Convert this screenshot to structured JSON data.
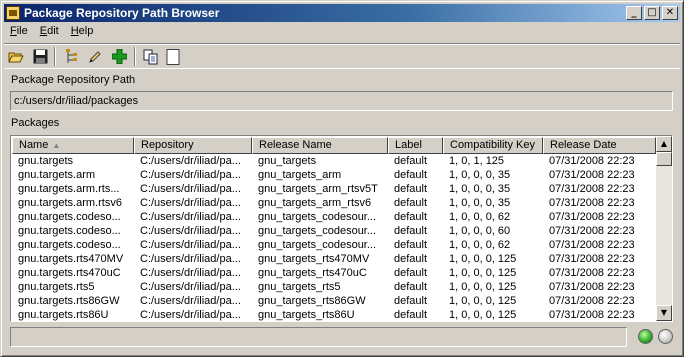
{
  "window": {
    "title": "Package Repository Path Browser",
    "controls": {
      "minimize": "_",
      "maximize": "□",
      "close": "✕"
    }
  },
  "menu": [
    {
      "prefix": "",
      "accel": "F",
      "rest": "ile"
    },
    {
      "prefix": "",
      "accel": "E",
      "rest": "dit"
    },
    {
      "prefix": "",
      "accel": "H",
      "rest": "elp"
    }
  ],
  "toolbar": {
    "icons": [
      "open-folder-icon",
      "save-disk-icon",
      "tree-icon",
      "edit-pencil-icon",
      "add-plus-icon",
      "copy-icon",
      "blank-page-icon"
    ]
  },
  "path_section": {
    "label": "Package Repository Path",
    "value": "c:/users/dr/iliad/packages"
  },
  "packages_section": {
    "label": "Packages",
    "columns": [
      "Name",
      "Repository",
      "Release Name",
      "Label",
      "Compatibility Key",
      "Release Date"
    ],
    "sort_indicator": "▲",
    "rows": [
      [
        "gnu.targets",
        "C:/users/dr/iliad/pa...",
        "gnu_targets",
        "default",
        "1, 0, 1, 125",
        "07/31/2008  22:23"
      ],
      [
        "gnu.targets.arm",
        "C:/users/dr/iliad/pa...",
        "gnu_targets_arm",
        "default",
        "1, 0, 0, 0, 35",
        "07/31/2008  22:23"
      ],
      [
        "gnu.targets.arm.rts...",
        "C:/users/dr/iliad/pa...",
        "gnu_targets_arm_rtsv5T",
        "default",
        "1, 0, 0, 0, 35",
        "07/31/2008  22:23"
      ],
      [
        "gnu.targets.arm.rtsv6",
        "C:/users/dr/iliad/pa...",
        "gnu_targets_arm_rtsv6",
        "default",
        "1, 0, 0, 0, 35",
        "07/31/2008  22:23"
      ],
      [
        "gnu.targets.codeso...",
        "C:/users/dr/iliad/pa...",
        "gnu_targets_codesour...",
        "default",
        "1, 0, 0, 0, 62",
        "07/31/2008  22:23"
      ],
      [
        "gnu.targets.codeso...",
        "C:/users/dr/iliad/pa...",
        "gnu_targets_codesour...",
        "default",
        "1, 0, 0, 0, 60",
        "07/31/2008  22:23"
      ],
      [
        "gnu.targets.codeso...",
        "C:/users/dr/iliad/pa...",
        "gnu_targets_codesour...",
        "default",
        "1, 0, 0, 0, 62",
        "07/31/2008  22:23"
      ],
      [
        "gnu.targets.rts470MV",
        "C:/users/dr/iliad/pa...",
        "gnu_targets_rts470MV",
        "default",
        "1, 0, 0, 0, 125",
        "07/31/2008  22:23"
      ],
      [
        "gnu.targets.rts470uC",
        "C:/users/dr/iliad/pa...",
        "gnu_targets_rts470uC",
        "default",
        "1, 0, 0, 0, 125",
        "07/31/2008  22:23"
      ],
      [
        "gnu.targets.rts5",
        "C:/users/dr/iliad/pa...",
        "gnu_targets_rts5",
        "default",
        "1, 0, 0, 0, 125",
        "07/31/2008  22:23"
      ],
      [
        "gnu.targets.rts86GW",
        "C:/users/dr/iliad/pa...",
        "gnu_targets_rts86GW",
        "default",
        "1, 0, 0, 0, 125",
        "07/31/2008  22:23"
      ],
      [
        "gnu.targets.rts86U",
        "C:/users/dr/iliad/pa...",
        "gnu_targets_rts86U",
        "default",
        "1, 0, 0, 0, 125",
        "07/31/2008  22:23"
      ]
    ]
  },
  "scrollbar": {
    "up": "▲",
    "down": "▼"
  },
  "status": {
    "text": "",
    "indicators": [
      {
        "name": "status-ok-light",
        "color": "#2ea82a"
      },
      {
        "name": "status-idle-light",
        "color": "#c8c8c8"
      }
    ]
  }
}
